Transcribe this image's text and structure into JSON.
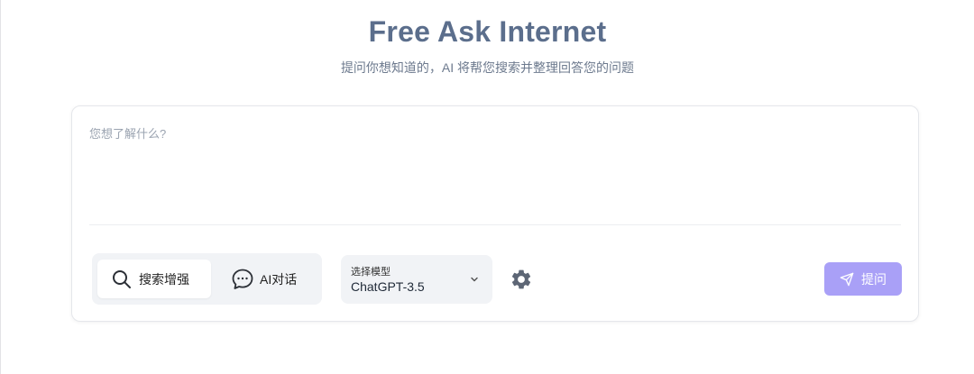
{
  "header": {
    "title": "Free Ask Internet",
    "subtitle": "提问你想知道的，AI 将帮您搜索并整理回答您的问题"
  },
  "query": {
    "placeholder": "您想了解什么?",
    "value": ""
  },
  "modes": [
    {
      "label": "搜索增强",
      "icon": "search-icon",
      "selected": true
    },
    {
      "label": "AI对话",
      "icon": "chat-bubble-icon",
      "selected": false
    }
  ],
  "model": {
    "caption": "选择模型",
    "selected": "ChatGPT-3.5",
    "icon": "chevron-down-icon"
  },
  "settings": {
    "icon": "gear-icon"
  },
  "submit": {
    "label": "提问",
    "icon": "send-icon"
  },
  "colors": {
    "title": "#5b6e8c",
    "accent": "#a9a0f7",
    "panel_bg": "#f1f3f6"
  }
}
